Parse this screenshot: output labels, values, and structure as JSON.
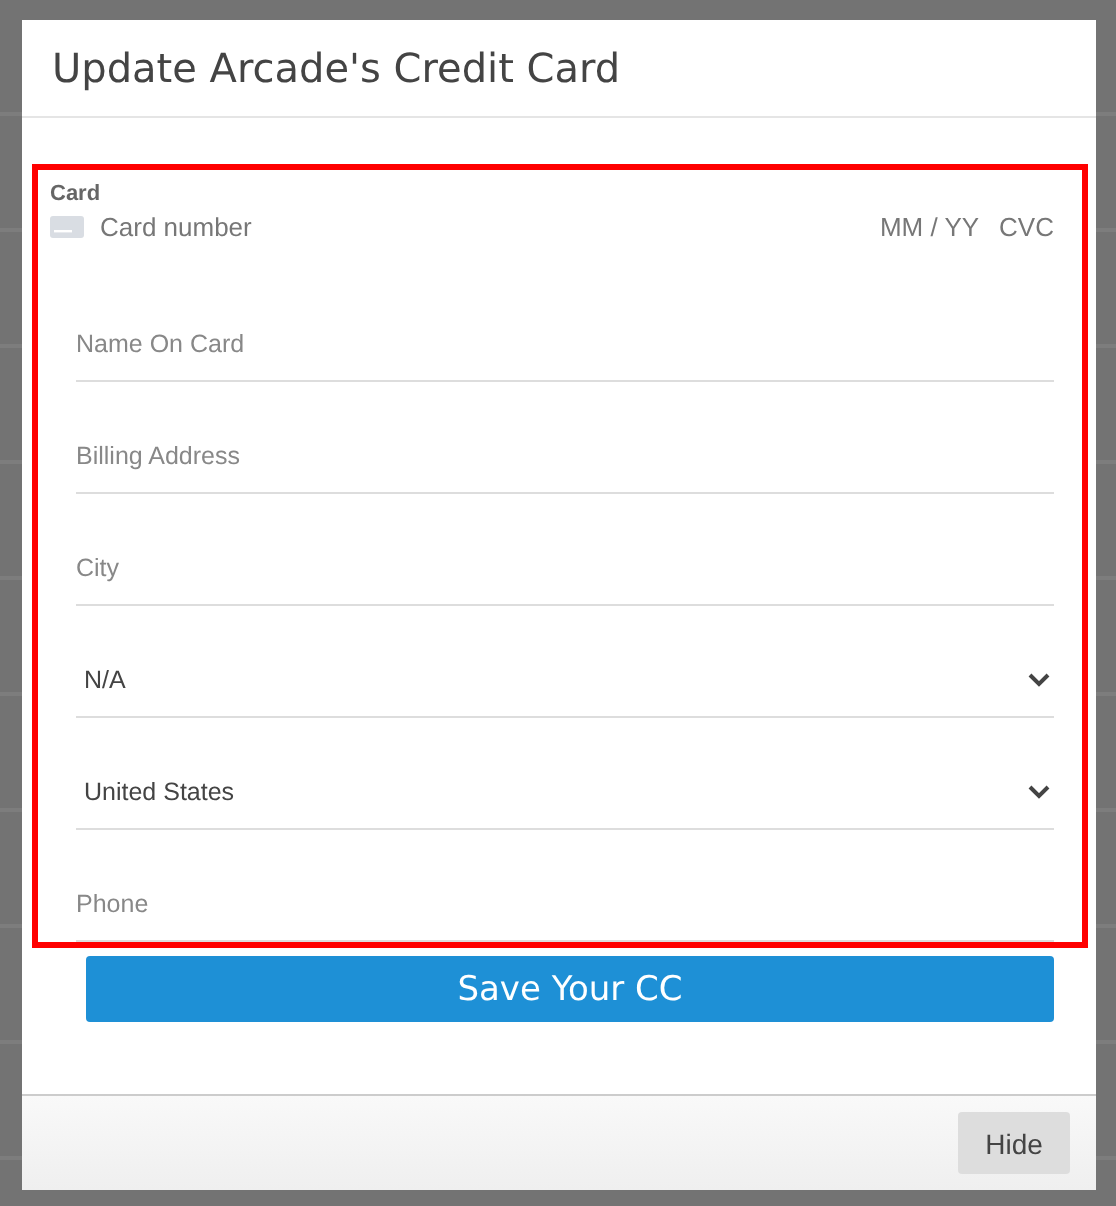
{
  "dialog": {
    "title": "Update Arcade's Credit Card"
  },
  "card_element": {
    "label": "Card",
    "number_placeholder": "Card number",
    "expiry_placeholder": "MM / YY",
    "cvc_placeholder": "CVC"
  },
  "fields": [
    {
      "kind": "text",
      "placeholder": "Name On Card"
    },
    {
      "kind": "text",
      "placeholder": "Billing Address"
    },
    {
      "kind": "text",
      "placeholder": "City"
    },
    {
      "kind": "select",
      "value": "N/A"
    },
    {
      "kind": "select",
      "value": "United States"
    },
    {
      "kind": "text",
      "placeholder": "Phone"
    }
  ],
  "submit_button": "Save Your CC",
  "footer": {
    "button": "Hide"
  }
}
